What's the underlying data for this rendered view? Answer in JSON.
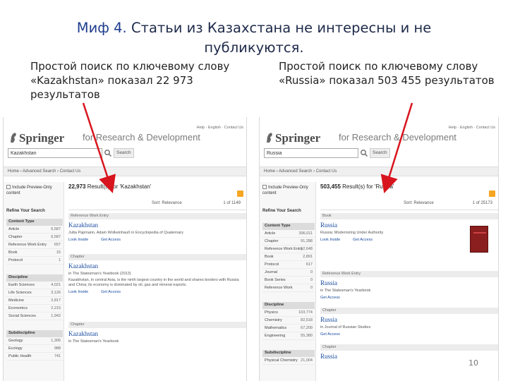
{
  "slide": {
    "title_prefix": "Миф 4.",
    "title_rest": " Статьи из Казахстана не интересны и не публикуются.",
    "caption_left": "Простой поиск по ключевому слову «Kazakhstan» показал 22 973 результатов",
    "caption_right": "Простой поиск по ключевому слову «Russia» показал 503 455 результатов",
    "page_number": "10"
  },
  "left_screen": {
    "top_links": "Help  ·  English  ·  Contact Us",
    "logo": "Springer",
    "tagline": "for Research & Development",
    "search_value": "Kazakhstan",
    "search_button": "Search",
    "breadcrumb": "Home  ›  Advanced Search  ›  Contact Us",
    "include_preview": "Include Preview-Only content",
    "refine_label": "Refine Your Search",
    "results_count": "22,973",
    "results_label": "Result(s) for 'Kazakhstan'",
    "sort_label": "Sort: Relevance",
    "pager": "1 of 1149",
    "facets": [
      {
        "title": "Content Type",
        "rows": [
          {
            "label": "Article",
            "count": "6,587"
          },
          {
            "label": "Chapter",
            "count": "6,587"
          },
          {
            "label": "Reference Work Entry",
            "count": "657"
          },
          {
            "label": "Book",
            "count": "15"
          },
          {
            "label": "Protocol",
            "count": "1"
          }
        ]
      },
      {
        "title": "Discipline",
        "rows": [
          {
            "label": "Earth Sciences",
            "count": "4,021"
          },
          {
            "label": "Life Sciences",
            "count": "3,126"
          },
          {
            "label": "Medicine",
            "count": "2,817"
          },
          {
            "label": "Economics",
            "count": "2,215"
          },
          {
            "label": "Social Sciences",
            "count": "1,942"
          }
        ]
      },
      {
        "title": "Subdiscipline",
        "rows": [
          {
            "label": "Geology",
            "count": "1,305"
          },
          {
            "label": "Ecology",
            "count": "988"
          },
          {
            "label": "Public Health",
            "count": "741"
          }
        ]
      }
    ],
    "results": [
      {
        "type": "Reference Work Entry",
        "title": "Kazakhstan",
        "meta": "Jutta Papmann, Adam Wolkeinhauß in Encyclopedia of Quaternary",
        "snippet": "",
        "links": [
          "Look Inside",
          "Get Access"
        ]
      },
      {
        "type": "Chapter",
        "title": "Kazakhstan",
        "meta": "in The Statesman's Yearbook (2013)",
        "snippet": "Kazakhstan, in central Asia, is the ninth largest country in the world and shares borders with Russia and China; its economy is dominated by oil, gas and mineral exports.",
        "links": [
          "Look Inside",
          "Get Access"
        ]
      },
      {
        "type": "Chapter",
        "title": "Kazakhstan",
        "meta": "in The Statesman's Yearbook",
        "snippet": "",
        "links": []
      }
    ]
  },
  "right_screen": {
    "top_links": "Help  ·  English  ·  Contact Us",
    "logo": "Springer",
    "tagline": "for Research & Development",
    "search_value": "Russia",
    "search_button": "Search",
    "breadcrumb": "Home  ›  Advanced Search  ›  Contact Us",
    "include_preview": "Include Preview-Only content",
    "refine_label": "Refine Your Search",
    "results_count": "503,455",
    "results_label": "Result(s) for 'Russia'",
    "sort_label": "Sort: Relevance",
    "pager": "1 of 25173",
    "facets": [
      {
        "title": "Content Type",
        "rows": [
          {
            "label": "Article",
            "count": "396,011"
          },
          {
            "label": "Chapter",
            "count": "91,288"
          },
          {
            "label": "Reference Work Entry",
            "count": "12,648"
          },
          {
            "label": "Book",
            "count": "2,891"
          },
          {
            "label": "Protocol",
            "count": "617"
          },
          {
            "label": "Journal",
            "count": "0"
          },
          {
            "label": "Book Series",
            "count": "0"
          },
          {
            "label": "Reference Work",
            "count": "0"
          }
        ]
      },
      {
        "title": "Discipline",
        "rows": [
          {
            "label": "Physics",
            "count": "103,774"
          },
          {
            "label": "Chemistry",
            "count": "82,518"
          },
          {
            "label": "Mathematics",
            "count": "67,209"
          },
          {
            "label": "Engineering",
            "count": "55,380"
          }
        ]
      },
      {
        "title": "Subdiscipline",
        "rows": [
          {
            "label": "Physical Chemistry",
            "count": "21,004"
          }
        ]
      }
    ],
    "results": [
      {
        "type": "Book",
        "title": "Russia",
        "meta": "Russia: Modernizing Under Authority",
        "snippet": "",
        "links": [
          "Look Inside",
          "Get Access"
        ]
      },
      {
        "type": "Reference Work Entry",
        "title": "Russia",
        "meta": "in The Statesman's Yearbook",
        "snippet": "",
        "links": [
          "Get Access"
        ]
      },
      {
        "type": "Chapter",
        "title": "Russia",
        "meta": "in Journal of Russian Studies",
        "snippet": "",
        "links": [
          "Get Access"
        ]
      },
      {
        "type": "Chapter",
        "title": "Russia",
        "meta": "",
        "snippet": "",
        "links": []
      }
    ]
  },
  "colors": {
    "title_accent": "#1f3d8c",
    "link_blue": "#1a4ca0",
    "arrow_red": "#d8141e",
    "rss_orange": "#f5a623"
  }
}
